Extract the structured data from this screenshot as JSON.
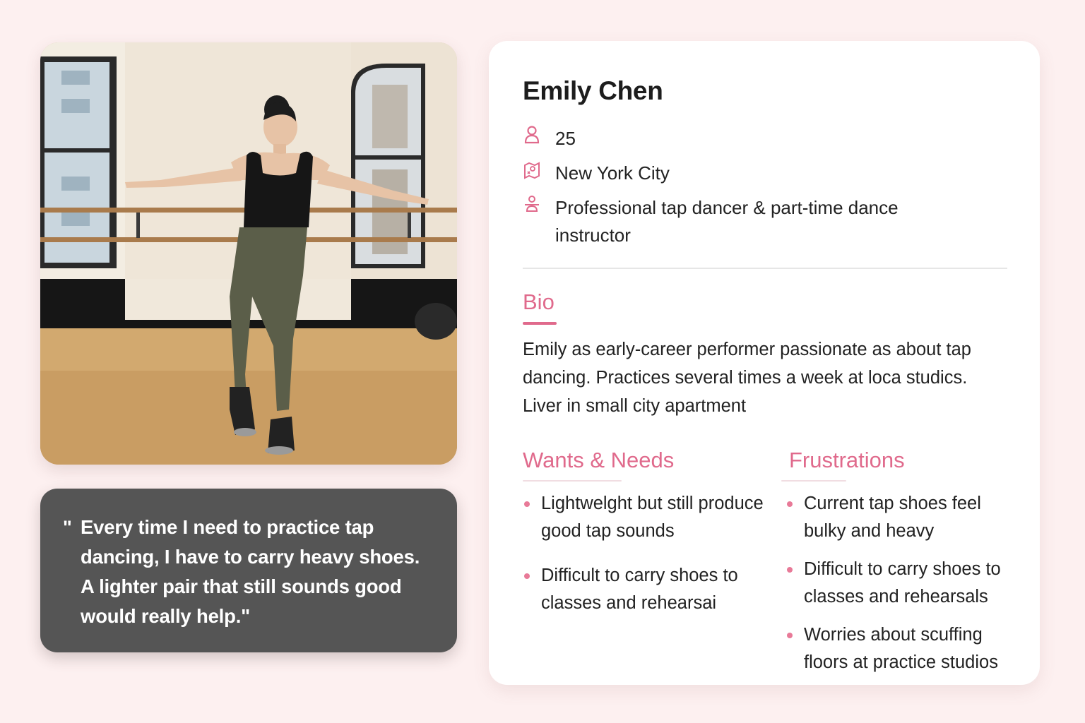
{
  "profile": {
    "name": "Emily Chen",
    "age": "25",
    "location": "New York City",
    "occupation": "Professional  tap dancer & part-time dance instructor"
  },
  "quote": {
    "mark": "\"",
    "text": "Every time I need to practice tap dancing, I have to carry heavy shoes. A lighter pair that still sounds good would really help.\""
  },
  "bio": {
    "title": "Bio",
    "text": "Emily as early-career performer passionate as about tap dancing. Practices several times a week at loca studics. Liver in small city apartment"
  },
  "wants": {
    "title": "Wants & Needs",
    "items": [
      "Lightwelght but still produce good tap sounds",
      "Difficult to carry shoes to classes and rehearsai"
    ]
  },
  "frustrations": {
    "title": "Frustrations",
    "items": [
      "Current tap shoes feel bulky and heavy",
      "Difficult to carry shoes to classes and rehearsals",
      "Worries about scuffing floors at practice studios"
    ]
  },
  "icons": {
    "age": "person-icon",
    "location": "map-icon",
    "occupation": "dancer-icon"
  },
  "colors": {
    "accent": "#e06a8c",
    "background": "#fdf0f0",
    "quote_bg": "#555555",
    "card_bg": "#ffffff"
  }
}
